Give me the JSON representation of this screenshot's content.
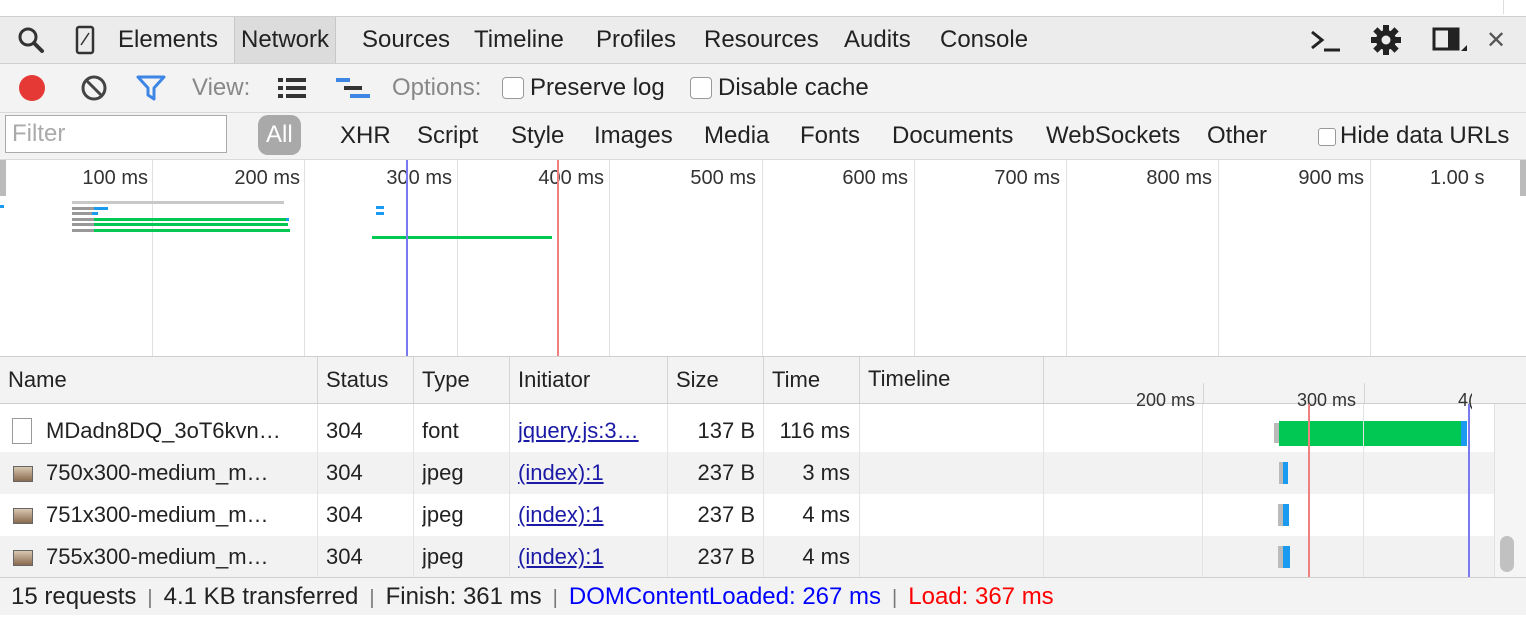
{
  "tabs": {
    "elements": "Elements",
    "network": "Network",
    "sources": "Sources",
    "timeline": "Timeline",
    "profiles": "Profiles",
    "resources": "Resources",
    "audits": "Audits",
    "console": "Console",
    "active": "Network"
  },
  "toolbar": {
    "view_label": "View:",
    "options_label": "Options:",
    "preserve_log": "Preserve log",
    "disable_cache": "Disable cache"
  },
  "filter": {
    "placeholder": "Filter",
    "types": [
      "All",
      "XHR",
      "Script",
      "Style",
      "Images",
      "Media",
      "Fonts",
      "Documents",
      "WebSockets",
      "Other"
    ],
    "selected": "All",
    "hide_data_urls": "Hide data URLs"
  },
  "overview": {
    "ticks": [
      "100 ms",
      "200 ms",
      "300 ms",
      "400 ms",
      "500 ms",
      "600 ms",
      "700 ms",
      "800 ms",
      "900 ms",
      "1.00 s"
    ]
  },
  "table": {
    "columns": [
      "Name",
      "Status",
      "Type",
      "Initiator",
      "Size",
      "Time",
      "Timeline"
    ],
    "timeline_ticks": [
      "200 ms",
      "300 ms",
      "4("
    ],
    "rows": [
      {
        "name": "MDadn8DQ_3oT6kvn…",
        "status": "304",
        "type": "font",
        "initiator": "jquery.js:3…",
        "size": "137 B",
        "time": "116 ms",
        "icon": "file-icon"
      },
      {
        "name": "750x300-medium_m…",
        "status": "304",
        "type": "jpeg",
        "initiator": "(index):1",
        "size": "237 B",
        "time": "3 ms",
        "icon": "image-icon"
      },
      {
        "name": "751x300-medium_m…",
        "status": "304",
        "type": "jpeg",
        "initiator": "(index):1",
        "size": "237 B",
        "time": "4 ms",
        "icon": "image-icon"
      },
      {
        "name": "755x300-medium_m…",
        "status": "304",
        "type": "jpeg",
        "initiator": "(index):1",
        "size": "237 B",
        "time": "4 ms",
        "icon": "image-icon"
      }
    ]
  },
  "status": {
    "requests": "15 requests",
    "transferred": "4.1 KB transferred",
    "finish": "Finish: 361 ms",
    "dcl": "DOMContentLoaded: 267 ms",
    "load": "Load: 367 ms"
  },
  "colors": {
    "dcl": "#0000ff",
    "load": "#ff0000",
    "record": "#e53935",
    "filter_icon": "#3d86e6",
    "waterfall_green": "#00c853",
    "waterfall_blue": "#1a9bf0"
  }
}
